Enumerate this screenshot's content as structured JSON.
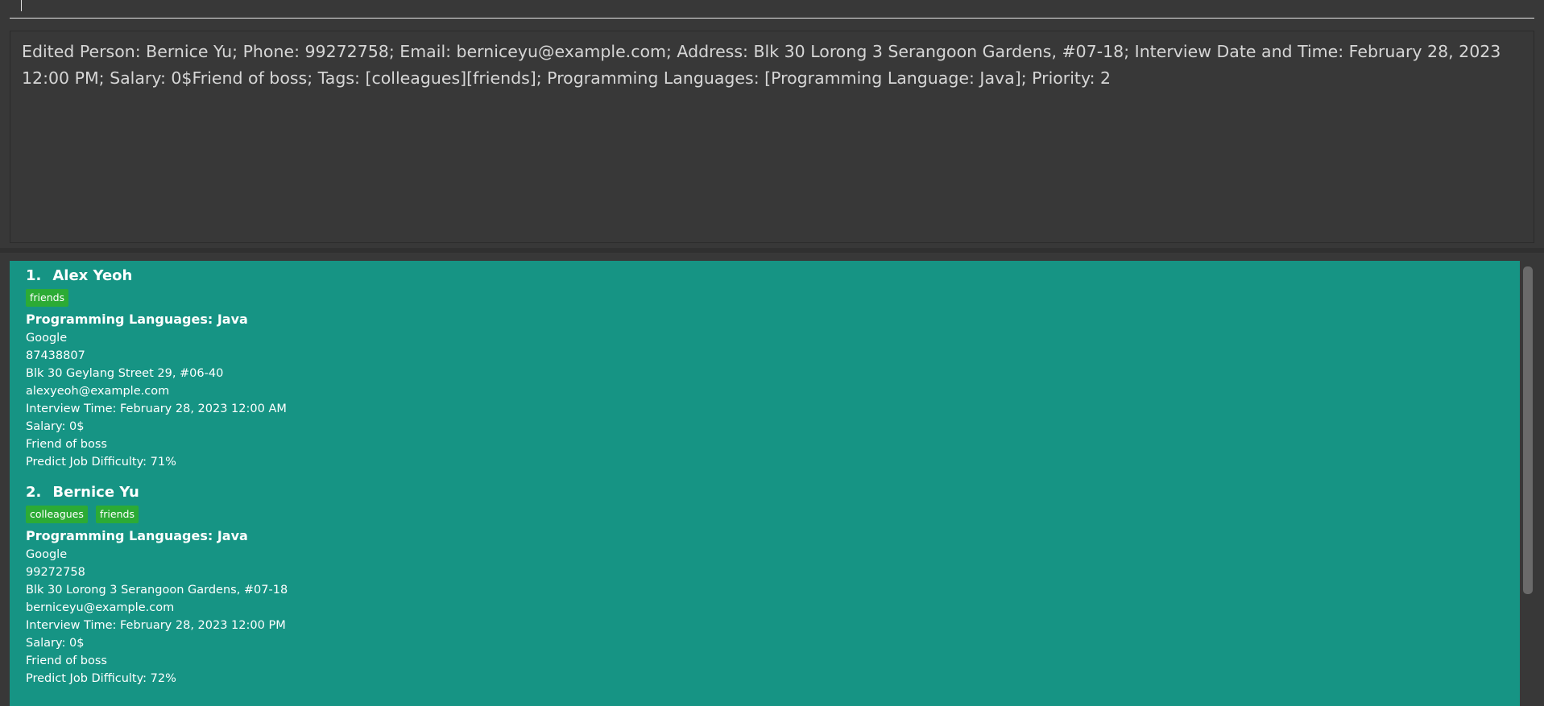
{
  "command": {
    "value": "",
    "placeholder": ""
  },
  "result": {
    "text": "Edited Person: Bernice Yu; Phone: 99272758; Email: berniceyu@example.com; Address: Blk 30 Lorong 3 Serangoon Gardens, #07-18; Interview Date and Time: February 28, 2023 12:00 PM; Salary: 0$Friend of boss; Tags: [colleagues][friends]; Programming Languages: [Programming Language: Java]; Priority: 2"
  },
  "persons": [
    {
      "index": "1.",
      "name": "Alex Yeoh",
      "tags": [
        "friends"
      ],
      "languages": "Programming Languages: Java",
      "company": "Google",
      "phone": "87438807",
      "address": "Blk 30 Geylang Street 29, #06-40",
      "email": "alexyeoh@example.com",
      "interview": "Interview Time: February 28, 2023 12:00 AM",
      "salary": "Salary: 0$",
      "note": "Friend of boss",
      "difficulty": "Predict Job Difficulty: 71%"
    },
    {
      "index": "2.",
      "name": "Bernice Yu",
      "tags": [
        "colleagues",
        "friends"
      ],
      "languages": "Programming Languages: Java",
      "company": "Google",
      "phone": "99272758",
      "address": "Blk 30 Lorong 3 Serangoon Gardens, #07-18",
      "email": "berniceyu@example.com",
      "interview": "Interview Time: February 28, 2023 12:00 PM",
      "salary": "Salary: 0$",
      "note": "Friend of boss",
      "difficulty": "Predict Job Difficulty: 72%"
    }
  ],
  "colors": {
    "background": "#383838",
    "list_background": "#169484",
    "tag_background": "#2cab35",
    "text": "#ffffff",
    "result_text": "#d6d6d6"
  }
}
